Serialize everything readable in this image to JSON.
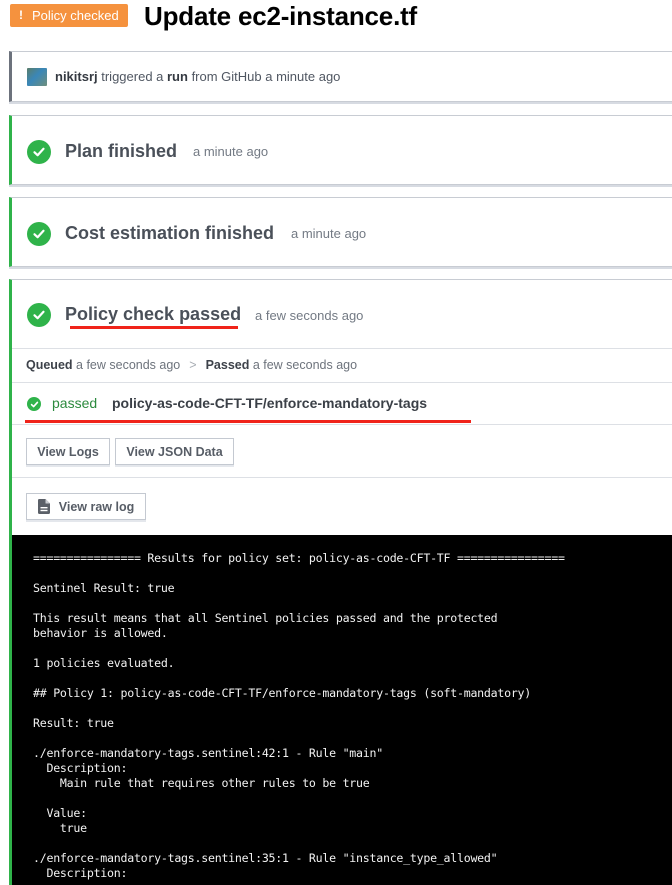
{
  "header": {
    "badge_icon": "exclamation-icon",
    "badge_bang": "!",
    "badge_label": "Policy checked",
    "title": "Update ec2-instance.tf",
    "colors": {
      "badge": "#f5923e",
      "success": "#2fb34a",
      "annotation": "#f0231a"
    }
  },
  "trigger": {
    "user": "nikitsrj",
    "text_1": " triggered a ",
    "run": "run",
    "text_2": " from GitHub a minute ago"
  },
  "steps": [
    {
      "title": "Plan finished",
      "time": "a minute ago",
      "icon": "check-circle-icon"
    },
    {
      "title": "Cost estimation finished",
      "time": "a minute ago",
      "icon": "check-circle-icon"
    },
    {
      "title": "Policy check passed",
      "time": "a few seconds ago",
      "icon": "check-circle-icon"
    }
  ],
  "policy": {
    "timeline": {
      "queued_label": "Queued",
      "queued_time": " a few seconds ago",
      "separator": ">",
      "passed_label": "Passed",
      "passed_time": " a few seconds ago"
    },
    "result": {
      "status": "passed",
      "name": "policy-as-code-CFT-TF/enforce-mandatory-tags"
    },
    "buttons": {
      "view_logs": "View Logs",
      "view_json": "View JSON Data",
      "view_raw_log": "View raw log"
    },
    "log_lines": [
      "================ Results for policy set: policy-as-code-CFT-TF ================",
      "",
      "Sentinel Result: true",
      "",
      "This result means that all Sentinel policies passed and the protected",
      "behavior is allowed.",
      "",
      "1 policies evaluated.",
      "",
      "## Policy 1: policy-as-code-CFT-TF/enforce-mandatory-tags (soft-mandatory)",
      "",
      "Result: true",
      "",
      "./enforce-mandatory-tags.sentinel:42:1 - Rule \"main\"",
      "  Description:",
      "    Main rule that requires other rules to be true",
      "",
      "  Value:",
      "    true",
      "",
      "./enforce-mandatory-tags.sentinel:35:1 - Rule \"instance_type_allowed\"",
      "  Description:"
    ]
  }
}
